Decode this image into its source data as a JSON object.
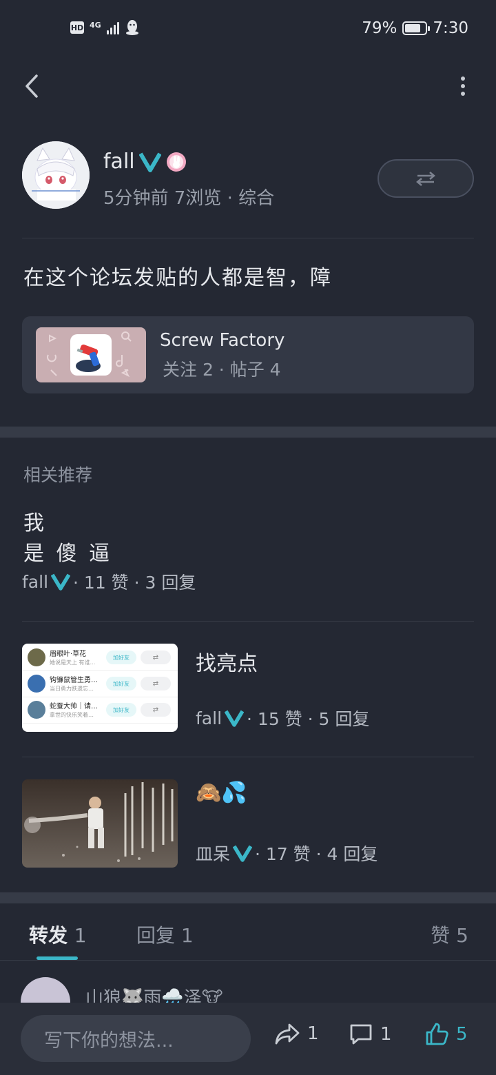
{
  "status_bar": {
    "hd": "HD",
    "network": "4G",
    "battery_percent": "79%",
    "battery_level": 0.79,
    "time": "7:30"
  },
  "nav": {
    "back_icon": "chevron-left-icon",
    "more_icon": "more-vertical-icon"
  },
  "author": {
    "name": "fall",
    "meta": "5分钟前 7浏览 · 综合",
    "verified_color": "#3bb7c8",
    "badge_color": "#f3a9c3"
  },
  "post": {
    "text": "在这个论坛发贴的人都是智，障"
  },
  "forum": {
    "name": "Screw Factory",
    "stats": "关注 2 · 帖子 4"
  },
  "recommendations": {
    "title": "相关推荐",
    "items": [
      {
        "title_line1": "我",
        "title_line2": "是 傻 逼",
        "author": "fall",
        "stats": "· 11 赞 · 3 回复"
      },
      {
        "title": "找亮点",
        "author": "fall",
        "stats": "· 15 赞 · 5 回复",
        "thumb_rows": [
          {
            "name": "眉眼叶·草花",
            "sub": "她说是天上 有谁…",
            "btn": "加好友"
          },
          {
            "name": "钩镰鼠管生勇…",
            "sub": "当日勇力跌遗忘…",
            "btn": "加好友"
          },
          {
            "name": "蛇蚕大帅｜请…",
            "sub": "拿世的快乐笑着…",
            "btn": "加好友"
          }
        ]
      },
      {
        "title": "🙈💦",
        "author": "皿呆",
        "stats": "· 17 赞 · 4 回复"
      }
    ]
  },
  "tabs": {
    "repost": "转发",
    "repost_count": "1",
    "reply": "回复",
    "reply_count": "1",
    "like": "赞",
    "like_count": "5"
  },
  "comment_preview": {
    "name": "山狼🐺雨🌧️泽🐮"
  },
  "bottom_bar": {
    "placeholder": "写下你的想法...",
    "share_count": "1",
    "comment_count": "1",
    "like_count": "5",
    "accent": "#3bb7c8"
  }
}
